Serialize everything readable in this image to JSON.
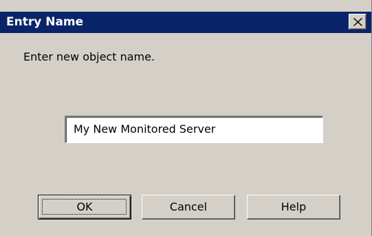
{
  "window": {
    "title": "Entry Name",
    "close_icon": "close-icon"
  },
  "content": {
    "prompt": "Enter new object name.",
    "name_value": "My New Monitored Server"
  },
  "buttons": {
    "ok_label": "OK",
    "cancel_label": "Cancel",
    "help_label": "Help"
  },
  "colors": {
    "titlebar": "#0a246a",
    "dialog_bg": "#d4d0c8"
  }
}
